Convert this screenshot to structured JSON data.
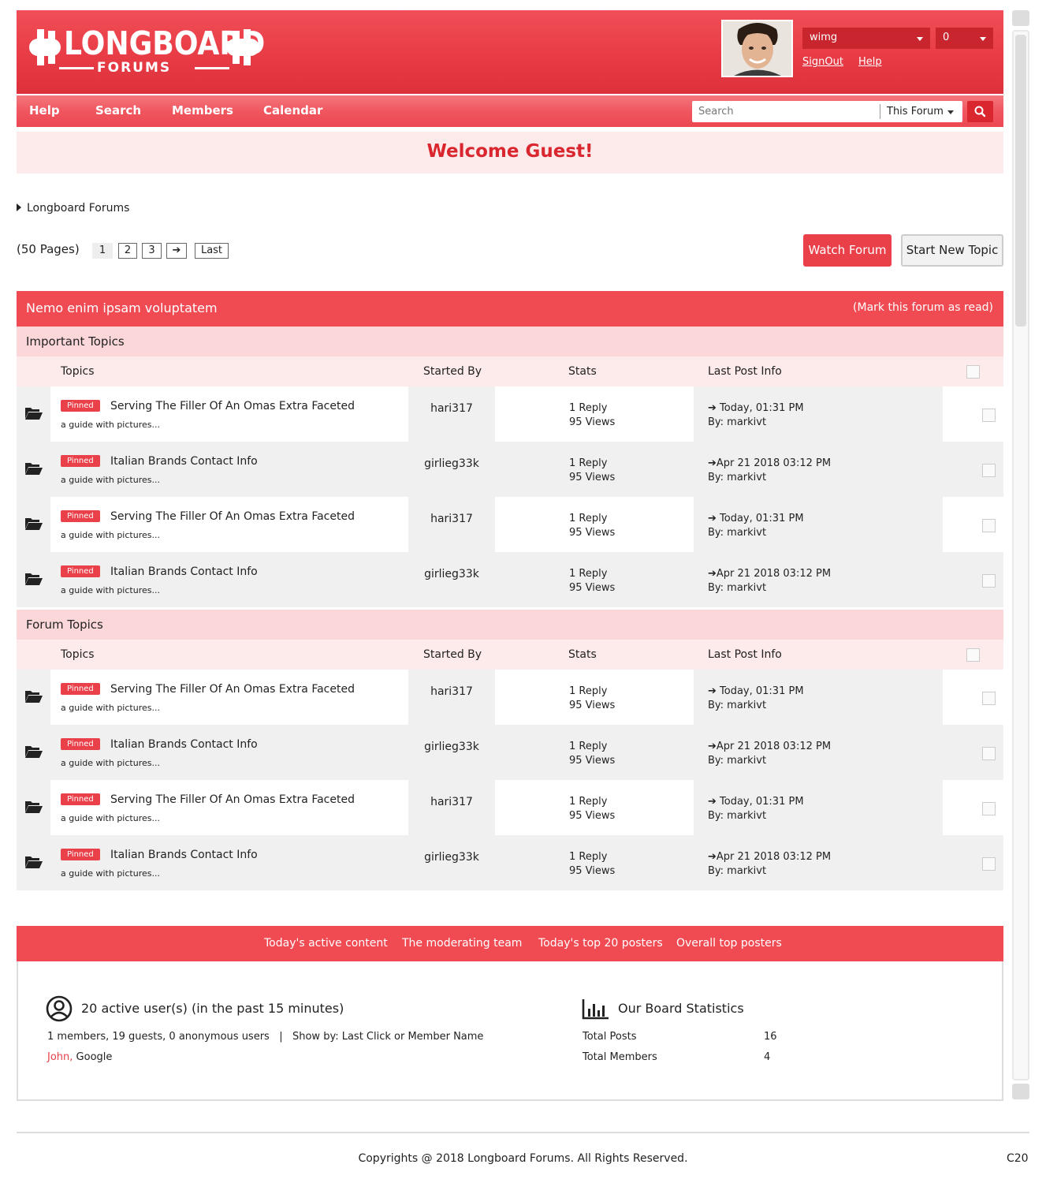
{
  "header": {
    "logo_text": "LONGBOARD",
    "logo_subtext": "FORUMS",
    "user_dropdown": "wimg",
    "count_dropdown": "0",
    "signout": "SignOut",
    "help": "Help"
  },
  "nav": {
    "items": [
      "Help",
      "Search",
      "Members",
      "Calendar"
    ],
    "search_placeholder": "Search",
    "search_scope": "This Forum"
  },
  "welcome": "Welcome Guest!",
  "breadcrumb": "Longboard Forums",
  "pagination": {
    "label": "(50 Pages)",
    "pages": [
      "1",
      "2",
      "3"
    ],
    "next": "➔",
    "last": "Last",
    "current": "1"
  },
  "actions": {
    "watch": "Watch Forum",
    "new_topic": "Start New Topic"
  },
  "forum": {
    "title": "Nemo enim ipsam voluptatem",
    "mark_read": "(Mark this forum as read)",
    "columns": {
      "topics": "Topics",
      "started_by": "Started By",
      "stats": "Stats",
      "last_post": "Last Post Info"
    },
    "sections": [
      {
        "title": "Important Topics",
        "rows": [
          {
            "badge": "Pinned",
            "title": "Serving The Filler Of An Omas Extra Faceted",
            "desc": "a guide with pictures...",
            "starter": "hari317",
            "replies": "1 Reply",
            "views": "95 Views",
            "last": "➔ Today, 01:31 PM",
            "by": "By: markivt"
          },
          {
            "badge": "Pinned",
            "title": "Italian Brands Contact Info",
            "desc": "a guide with pictures...",
            "starter": "girlieg33k",
            "replies": "1 Reply",
            "views": "95 Views",
            "last": "➔Apr 21 2018 03:12 PM",
            "by": "By: markivt"
          },
          {
            "badge": "Pinned",
            "title": "Serving The Filler Of An Omas Extra Faceted",
            "desc": "a guide with pictures...",
            "starter": "hari317",
            "replies": "1 Reply",
            "views": "95 Views",
            "last": "➔ Today, 01:31 PM",
            "by": "By: markivt"
          },
          {
            "badge": "Pinned",
            "title": "Italian Brands Contact Info",
            "desc": "a guide with pictures...",
            "starter": "girlieg33k",
            "replies": "1 Reply",
            "views": "95 Views",
            "last": "➔Apr 21 2018 03:12 PM",
            "by": "By: markivt"
          }
        ]
      },
      {
        "title": "Forum Topics",
        "rows": [
          {
            "badge": "Pinned",
            "title": "Serving The Filler Of An Omas Extra Faceted",
            "desc": "a guide with pictures...",
            "starter": "hari317",
            "replies": "1 Reply",
            "views": "95 Views",
            "last": "➔ Today, 01:31 PM",
            "by": "By: markivt"
          },
          {
            "badge": "Pinned",
            "title": "Italian Brands Contact Info",
            "desc": "a guide with pictures...",
            "starter": "girlieg33k",
            "replies": "1 Reply",
            "views": "95 Views",
            "last": "➔Apr 21 2018 03:12 PM",
            "by": "By: markivt"
          },
          {
            "badge": "Pinned",
            "title": "Serving The Filler Of An Omas Extra Faceted",
            "desc": "a guide with pictures...",
            "starter": "hari317",
            "replies": "1 Reply",
            "views": "95 Views",
            "last": "➔ Today, 01:31 PM",
            "by": "By: markivt"
          },
          {
            "badge": "Pinned",
            "title": "Italian Brands Contact Info",
            "desc": "a guide with pictures...",
            "starter": "girlieg33k",
            "replies": "1 Reply",
            "views": "95 Views",
            "last": "➔Apr 21 2018 03:12 PM",
            "by": "By: markivt"
          }
        ]
      }
    ]
  },
  "stats": {
    "links": [
      "Today's active content",
      "The moderating team",
      "Today's top 20 posters",
      "Overall top posters"
    ],
    "active_title": "20 active user(s) (in the past 15 minutes)",
    "active_detail": "1 members, 19 guests, 0 anonymous users   |   Show by: Last Click or Member Name",
    "active_member": "John,",
    "active_other": " Google",
    "board_title": "Our Board Statistics",
    "board": [
      {
        "label": "Total Posts",
        "value": "16"
      },
      {
        "label": "Total Members",
        "value": "4"
      }
    ]
  },
  "footer": {
    "copyright": "Copyrights @ 2018 Longboard Forums. All Rights Reserved.",
    "code": "C20"
  },
  "colors": {
    "brand_red": "#f04a53",
    "dark_red": "#d9262f",
    "pink_bg": "#fdeaea"
  }
}
